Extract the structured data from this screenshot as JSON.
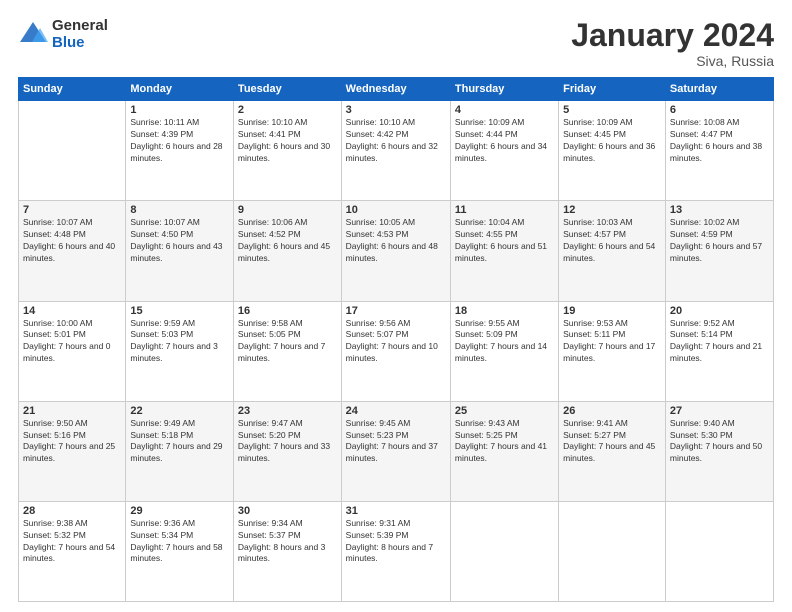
{
  "logo": {
    "general": "General",
    "blue": "Blue"
  },
  "header": {
    "month": "January 2024",
    "location": "Siva, Russia"
  },
  "weekdays": [
    "Sunday",
    "Monday",
    "Tuesday",
    "Wednesday",
    "Thursday",
    "Friday",
    "Saturday"
  ],
  "weeks": [
    [
      {
        "day": "",
        "sunrise": "",
        "sunset": "",
        "daylight": ""
      },
      {
        "day": "1",
        "sunrise": "Sunrise: 10:11 AM",
        "sunset": "Sunset: 4:39 PM",
        "daylight": "Daylight: 6 hours and 28 minutes."
      },
      {
        "day": "2",
        "sunrise": "Sunrise: 10:10 AM",
        "sunset": "Sunset: 4:41 PM",
        "daylight": "Daylight: 6 hours and 30 minutes."
      },
      {
        "day": "3",
        "sunrise": "Sunrise: 10:10 AM",
        "sunset": "Sunset: 4:42 PM",
        "daylight": "Daylight: 6 hours and 32 minutes."
      },
      {
        "day": "4",
        "sunrise": "Sunrise: 10:09 AM",
        "sunset": "Sunset: 4:44 PM",
        "daylight": "Daylight: 6 hours and 34 minutes."
      },
      {
        "day": "5",
        "sunrise": "Sunrise: 10:09 AM",
        "sunset": "Sunset: 4:45 PM",
        "daylight": "Daylight: 6 hours and 36 minutes."
      },
      {
        "day": "6",
        "sunrise": "Sunrise: 10:08 AM",
        "sunset": "Sunset: 4:47 PM",
        "daylight": "Daylight: 6 hours and 38 minutes."
      }
    ],
    [
      {
        "day": "7",
        "sunrise": "Sunrise: 10:07 AM",
        "sunset": "Sunset: 4:48 PM",
        "daylight": "Daylight: 6 hours and 40 minutes."
      },
      {
        "day": "8",
        "sunrise": "Sunrise: 10:07 AM",
        "sunset": "Sunset: 4:50 PM",
        "daylight": "Daylight: 6 hours and 43 minutes."
      },
      {
        "day": "9",
        "sunrise": "Sunrise: 10:06 AM",
        "sunset": "Sunset: 4:52 PM",
        "daylight": "Daylight: 6 hours and 45 minutes."
      },
      {
        "day": "10",
        "sunrise": "Sunrise: 10:05 AM",
        "sunset": "Sunset: 4:53 PM",
        "daylight": "Daylight: 6 hours and 48 minutes."
      },
      {
        "day": "11",
        "sunrise": "Sunrise: 10:04 AM",
        "sunset": "Sunset: 4:55 PM",
        "daylight": "Daylight: 6 hours and 51 minutes."
      },
      {
        "day": "12",
        "sunrise": "Sunrise: 10:03 AM",
        "sunset": "Sunset: 4:57 PM",
        "daylight": "Daylight: 6 hours and 54 minutes."
      },
      {
        "day": "13",
        "sunrise": "Sunrise: 10:02 AM",
        "sunset": "Sunset: 4:59 PM",
        "daylight": "Daylight: 6 hours and 57 minutes."
      }
    ],
    [
      {
        "day": "14",
        "sunrise": "Sunrise: 10:00 AM",
        "sunset": "Sunset: 5:01 PM",
        "daylight": "Daylight: 7 hours and 0 minutes."
      },
      {
        "day": "15",
        "sunrise": "Sunrise: 9:59 AM",
        "sunset": "Sunset: 5:03 PM",
        "daylight": "Daylight: 7 hours and 3 minutes."
      },
      {
        "day": "16",
        "sunrise": "Sunrise: 9:58 AM",
        "sunset": "Sunset: 5:05 PM",
        "daylight": "Daylight: 7 hours and 7 minutes."
      },
      {
        "day": "17",
        "sunrise": "Sunrise: 9:56 AM",
        "sunset": "Sunset: 5:07 PM",
        "daylight": "Daylight: 7 hours and 10 minutes."
      },
      {
        "day": "18",
        "sunrise": "Sunrise: 9:55 AM",
        "sunset": "Sunset: 5:09 PM",
        "daylight": "Daylight: 7 hours and 14 minutes."
      },
      {
        "day": "19",
        "sunrise": "Sunrise: 9:53 AM",
        "sunset": "Sunset: 5:11 PM",
        "daylight": "Daylight: 7 hours and 17 minutes."
      },
      {
        "day": "20",
        "sunrise": "Sunrise: 9:52 AM",
        "sunset": "Sunset: 5:14 PM",
        "daylight": "Daylight: 7 hours and 21 minutes."
      }
    ],
    [
      {
        "day": "21",
        "sunrise": "Sunrise: 9:50 AM",
        "sunset": "Sunset: 5:16 PM",
        "daylight": "Daylight: 7 hours and 25 minutes."
      },
      {
        "day": "22",
        "sunrise": "Sunrise: 9:49 AM",
        "sunset": "Sunset: 5:18 PM",
        "daylight": "Daylight: 7 hours and 29 minutes."
      },
      {
        "day": "23",
        "sunrise": "Sunrise: 9:47 AM",
        "sunset": "Sunset: 5:20 PM",
        "daylight": "Daylight: 7 hours and 33 minutes."
      },
      {
        "day": "24",
        "sunrise": "Sunrise: 9:45 AM",
        "sunset": "Sunset: 5:23 PM",
        "daylight": "Daylight: 7 hours and 37 minutes."
      },
      {
        "day": "25",
        "sunrise": "Sunrise: 9:43 AM",
        "sunset": "Sunset: 5:25 PM",
        "daylight": "Daylight: 7 hours and 41 minutes."
      },
      {
        "day": "26",
        "sunrise": "Sunrise: 9:41 AM",
        "sunset": "Sunset: 5:27 PM",
        "daylight": "Daylight: 7 hours and 45 minutes."
      },
      {
        "day": "27",
        "sunrise": "Sunrise: 9:40 AM",
        "sunset": "Sunset: 5:30 PM",
        "daylight": "Daylight: 7 hours and 50 minutes."
      }
    ],
    [
      {
        "day": "28",
        "sunrise": "Sunrise: 9:38 AM",
        "sunset": "Sunset: 5:32 PM",
        "daylight": "Daylight: 7 hours and 54 minutes."
      },
      {
        "day": "29",
        "sunrise": "Sunrise: 9:36 AM",
        "sunset": "Sunset: 5:34 PM",
        "daylight": "Daylight: 7 hours and 58 minutes."
      },
      {
        "day": "30",
        "sunrise": "Sunrise: 9:34 AM",
        "sunset": "Sunset: 5:37 PM",
        "daylight": "Daylight: 8 hours and 3 minutes."
      },
      {
        "day": "31",
        "sunrise": "Sunrise: 9:31 AM",
        "sunset": "Sunset: 5:39 PM",
        "daylight": "Daylight: 8 hours and 7 minutes."
      },
      {
        "day": "",
        "sunrise": "",
        "sunset": "",
        "daylight": ""
      },
      {
        "day": "",
        "sunrise": "",
        "sunset": "",
        "daylight": ""
      },
      {
        "day": "",
        "sunrise": "",
        "sunset": "",
        "daylight": ""
      }
    ]
  ]
}
